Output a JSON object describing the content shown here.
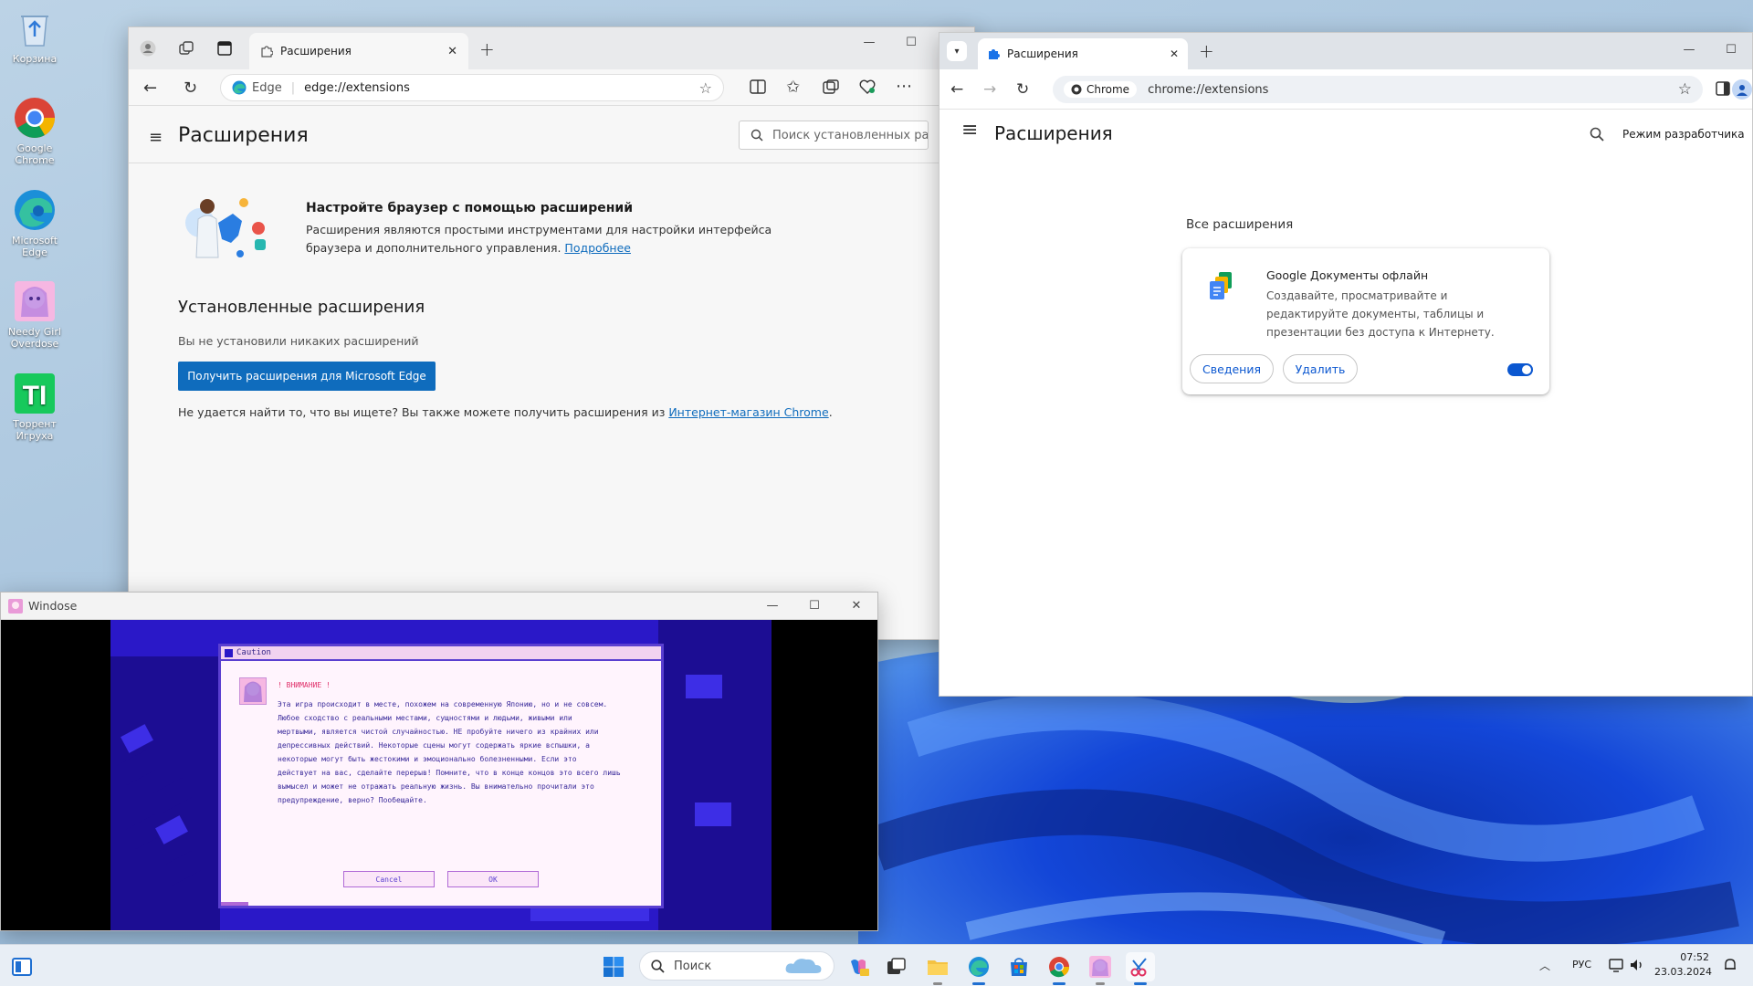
{
  "desktop": {
    "icons": [
      {
        "label": "Корзина",
        "icon": "recycle-bin-icon"
      },
      {
        "label": "Google Chrome",
        "icon": "chrome-icon"
      },
      {
        "label": "Microsoft Edge",
        "icon": "edge-icon"
      },
      {
        "label": "Needy Girl Overdose",
        "icon": "needy-girl-icon"
      },
      {
        "label": "Торрент Игруха",
        "icon": "torrent-igruha-icon"
      }
    ]
  },
  "edge": {
    "tab_title": "Расширения",
    "omni_brand": "Edge",
    "url": "edge://extensions",
    "page_title": "Расширения",
    "search_placeholder": "Поиск установленных ра",
    "promo_title": "Настройте браузер с помощью расширений",
    "promo_text": "Расширения являются простыми инструментами для настройки интерфейса браузера и дополнительного управления.",
    "promo_link": "Подробнее",
    "installed_heading": "Установленные расширения",
    "installed_empty": "Вы не установили никаких расширений",
    "get_button": "Получить расширения для Microsoft Edge",
    "footer_text": "Не удается найти то, что вы ищете? Вы также можете получить расширения из",
    "footer_link": "Интернет-магазин Chrome",
    "footer_end": "."
  },
  "chrome": {
    "tab_title": "Расширения",
    "omni_brand": "Chrome",
    "url": "chrome://extensions",
    "page_title": "Расширения",
    "dev_mode": "Режим разработчика",
    "section": "Все расширения",
    "ext_name": "Google Документы офлайн",
    "ext_desc": "Создавайте, просматривайте и редактируйте документы, таблицы и презентации без доступа к Интернету.",
    "details_button": "Сведения",
    "remove_button": "Удалить",
    "enabled": true
  },
  "windose": {
    "title": "Windose",
    "dialog_title": "Caution",
    "warning": "! ВНИМАНИЕ !",
    "body_lines": [
      "Эта игра происходит в месте, похожем на современную Японию, но и не совсем.",
      "Любое сходство с реальными местами, сущностями и людьми, живыми или",
      "мертвыми, является чистой случайностью. НЕ пробуйте ничего из крайних или",
      "депрессивных действий. Некоторые сцены могут содержать яркие вспышки, а",
      "некоторые могут быть жестокими и эмоционально болезненными. Если это",
      "действует на вас, сделайте перерыв! Помните, что в конце концов это всего лишь",
      "вымысел и может не отражать реальную жизнь. Вы внимательно прочитали это",
      "предупреждение, верно? Пообещайте."
    ],
    "cancel": "Cancel",
    "ok": "OK"
  },
  "taskbar": {
    "search_placeholder": "Поиск",
    "language": "РУС",
    "time": "07:52",
    "date": "23.03.2024"
  },
  "colors": {
    "edge_button": "#0f6cbd",
    "chrome_accent": "#0b57d0",
    "windose_bg": "#2a18c8",
    "dialog_border": "#5a3fd0"
  }
}
